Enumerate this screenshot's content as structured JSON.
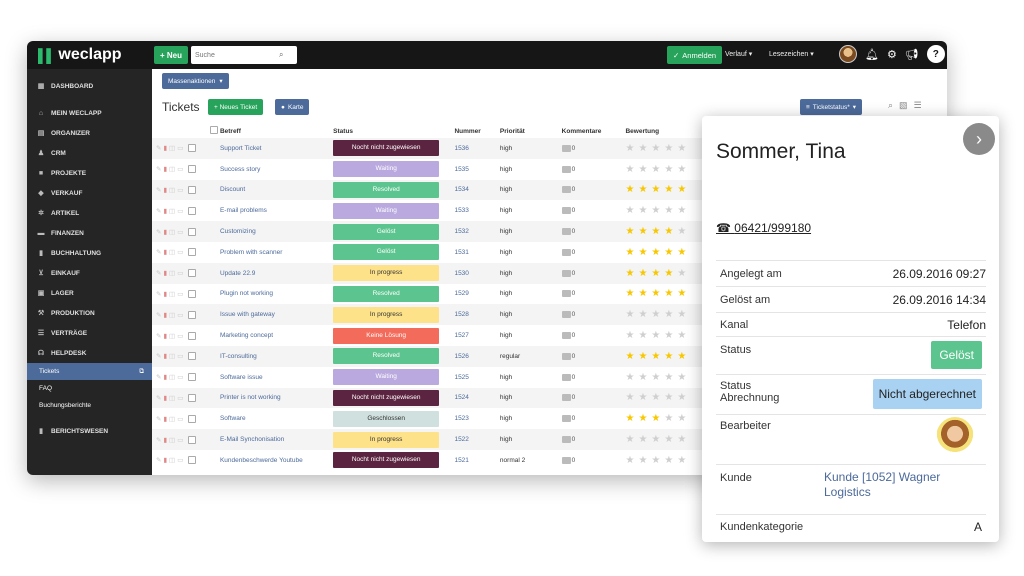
{
  "app": {
    "logo": "weclapp",
    "new_label": "+ Neu",
    "search_placeholder": "Suche",
    "login_label": "Anmelden",
    "menu_verlauf": "Verlauf",
    "menu_lesezeichen": "Lesezeichen"
  },
  "sidebar": {
    "items": [
      {
        "label": "DASHBOARD"
      },
      {
        "label": "MEIN WECLAPP"
      },
      {
        "label": "ORGANIZER"
      },
      {
        "label": "CRM"
      },
      {
        "label": "PROJEKTE"
      },
      {
        "label": "VERKAUF"
      },
      {
        "label": "ARTIKEL"
      },
      {
        "label": "FINANZEN"
      },
      {
        "label": "BUCHHALTUNG"
      },
      {
        "label": "EINKAUF"
      },
      {
        "label": "LAGER"
      },
      {
        "label": "PRODUKTION"
      },
      {
        "label": "VERTRÄGE"
      },
      {
        "label": "HELPDESK"
      }
    ],
    "sub": [
      {
        "label": "Tickets"
      },
      {
        "label": "FAQ"
      },
      {
        "label": "Buchungsberichte"
      }
    ],
    "reports": "BERICHTSWESEN"
  },
  "main": {
    "mass_actions": "Massenaktionen",
    "title": "Tickets",
    "new_ticket": "+ Neues Ticket",
    "map": "Karte",
    "filter": "Ticketstatus*",
    "columns": {
      "subject": "Betreff",
      "status": "Status",
      "number": "Nummer",
      "priority": "Priorität",
      "comments": "Kommentare",
      "rating": "Bewertung"
    },
    "rows": [
      {
        "subject": "Support Ticket",
        "status": "Nocht nicht zugewiesen",
        "status_color": "#5b2440",
        "number": "1536",
        "priority": "high",
        "comments": "0",
        "stars": 0
      },
      {
        "subject": "Success story",
        "status": "Waiting",
        "status_color": "#b9a9de",
        "number": "1535",
        "priority": "high",
        "comments": "0",
        "stars": 0
      },
      {
        "subject": "Discount",
        "status": "Resolved",
        "status_color": "#5cc48e",
        "number": "1534",
        "priority": "high",
        "comments": "0",
        "stars": 5
      },
      {
        "subject": "E-mail problems",
        "status": "Waiting",
        "status_color": "#b9a9de",
        "number": "1533",
        "priority": "high",
        "comments": "0",
        "stars": 0
      },
      {
        "subject": "Customizing",
        "status": "Gelöst",
        "status_color": "#5cc48e",
        "number": "1532",
        "priority": "high",
        "comments": "0",
        "stars": 4
      },
      {
        "subject": "Problem with scanner",
        "status": "Gelöst",
        "status_color": "#5cc48e",
        "number": "1531",
        "priority": "high",
        "comments": "0",
        "stars": 5
      },
      {
        "subject": "Update 22.9",
        "status": "In progress",
        "status_color": "#fde28a",
        "number": "1530",
        "priority": "high",
        "comments": "0",
        "stars": 4
      },
      {
        "subject": "Plugin not working",
        "status": "Resolved",
        "status_color": "#5cc48e",
        "number": "1529",
        "priority": "high",
        "comments": "0",
        "stars": 5
      },
      {
        "subject": "Issue with gateway",
        "status": "In progress",
        "status_color": "#fde28a",
        "number": "1528",
        "priority": "high",
        "comments": "0",
        "stars": 0
      },
      {
        "subject": "Marketing concept",
        "status": "Keine Lösung",
        "status_color": "#f26b5b",
        "number": "1527",
        "priority": "high",
        "comments": "0",
        "stars": 0
      },
      {
        "subject": "IT-consulting",
        "status": "Resolved",
        "status_color": "#5cc48e",
        "number": "1526",
        "priority": "regular",
        "comments": "0",
        "stars": 5
      },
      {
        "subject": "Software issue",
        "status": "Waiting",
        "status_color": "#b9a9de",
        "number": "1525",
        "priority": "high",
        "comments": "0",
        "stars": 0
      },
      {
        "subject": "Printer is not working",
        "status": "Nocht nicht zugewiesen",
        "status_color": "#5b2440",
        "number": "1524",
        "priority": "high",
        "comments": "0",
        "stars": 0
      },
      {
        "subject": "Software",
        "status": "Geschlossen",
        "status_color": "#cfe0de",
        "number": "1523",
        "priority": "high",
        "comments": "0",
        "stars": 3
      },
      {
        "subject": "E-Mail Synchonisation",
        "status": "In progress",
        "status_color": "#fde28a",
        "number": "1522",
        "priority": "high",
        "comments": "0",
        "stars": 0
      },
      {
        "subject": "Kundenbeschwerde Youtube",
        "status": "Nocht nicht zugewiesen",
        "status_color": "#5b2440",
        "number": "1521",
        "priority": "normal 2",
        "comments": "0",
        "stars": 0
      }
    ]
  },
  "card": {
    "name": "Sommer, Tina",
    "phone": "06421/999180",
    "created_label": "Angelegt am",
    "created_value": "26.09.2016 09:27",
    "resolved_label": "Gelöst am",
    "resolved_value": "26.09.2016 14:34",
    "channel_label": "Kanal",
    "channel_value": "Telefon",
    "status_label": "Status",
    "status_value": "Gelöst",
    "billing_label": "Status Abrechnung",
    "billing_value": "Nicht abgerechnet",
    "assignee_label": "Bearbeiter",
    "customer_label": "Kunde",
    "customer_value": "Kunde [1052] Wagner Logistics",
    "category_label": "Kundenkategorie",
    "category_value": "A"
  },
  "colors": {
    "accent_green": "#27a35b",
    "accent_blue": "#4c6a9a",
    "sidebar_bg": "#252525",
    "topbar_bg": "#161616",
    "star_on": "#f7c700"
  }
}
